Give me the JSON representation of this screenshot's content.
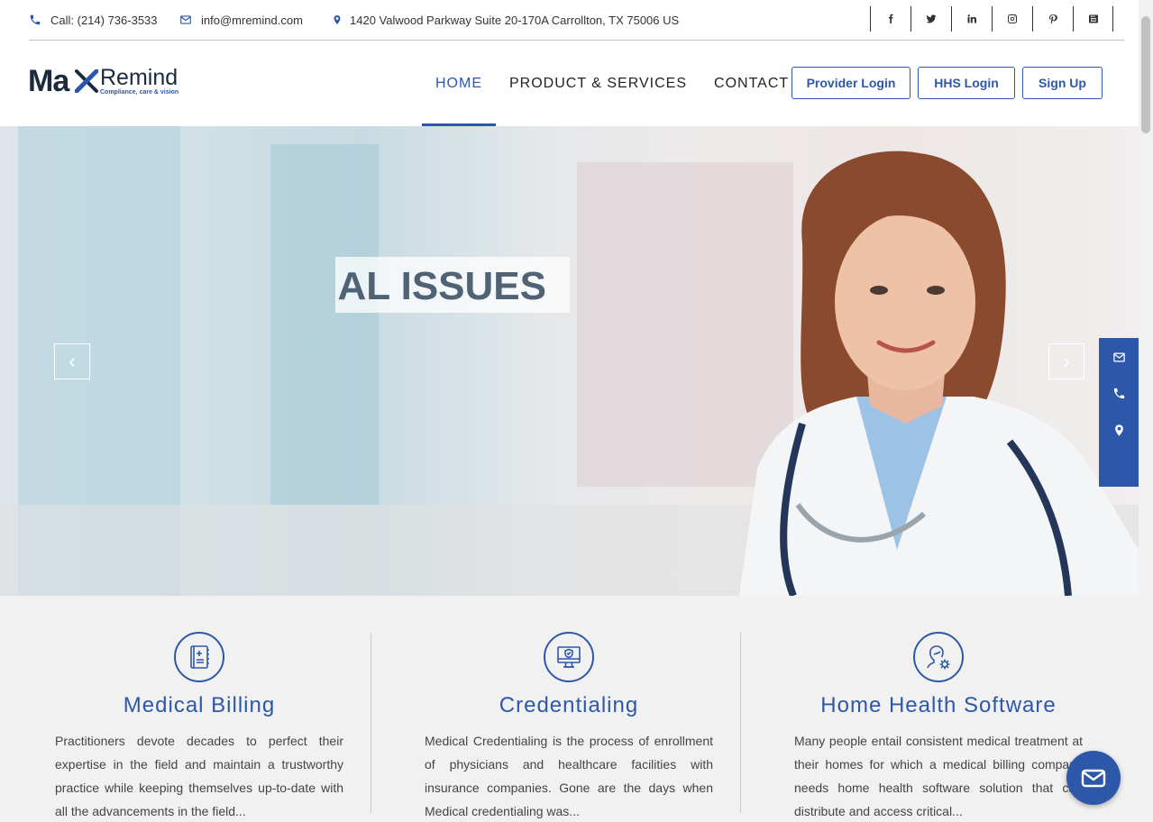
{
  "topbar": {
    "phone": "Call: (214) 736-3533",
    "email": "info@mremind.com",
    "address": "1420 Valwood Parkway Suite 20-170A Carrollton, TX 75006 US",
    "social": [
      "facebook-icon",
      "twitter-icon",
      "linkedin-icon",
      "instagram-icon",
      "pinterest-icon",
      "youtube-icon"
    ]
  },
  "logo": {
    "main": "Ma",
    "remind": "Remind",
    "tagline": "Compliance, care & vision"
  },
  "nav": {
    "items": [
      "HOME",
      "PRODUCT & SERVICES",
      "CONTACT"
    ],
    "active": "HOME"
  },
  "buttons": {
    "provider_login": "Provider Login",
    "hhs_login": "HHS Login",
    "sign_up": "Sign Up"
  },
  "hero": {
    "caption": "CIAL ISSUES",
    "prev": "‹",
    "next": "›"
  },
  "services": [
    {
      "title": "Medical Billing",
      "text": "Practitioners devote decades to perfect their expertise in the field and maintain a trustworthy practice while keeping themselves up-to-date with all the advancements in the field..."
    },
    {
      "title": "Credentialing",
      "text": "Medical Credentialing is the process of enrollment of physicians and healthcare facilities with insurance companies. Gone are the days when Medical credentialing was..."
    },
    {
      "title": "Home Health Software",
      "text": "Many people entail consistent medical treatment at their homes for which a medical billing company needs home health software solution that can distribute and access critical..."
    }
  ],
  "colors": {
    "brand": "#2d58a9",
    "dark": "#1b2a3e",
    "section_bg": "#f1f1f1"
  }
}
